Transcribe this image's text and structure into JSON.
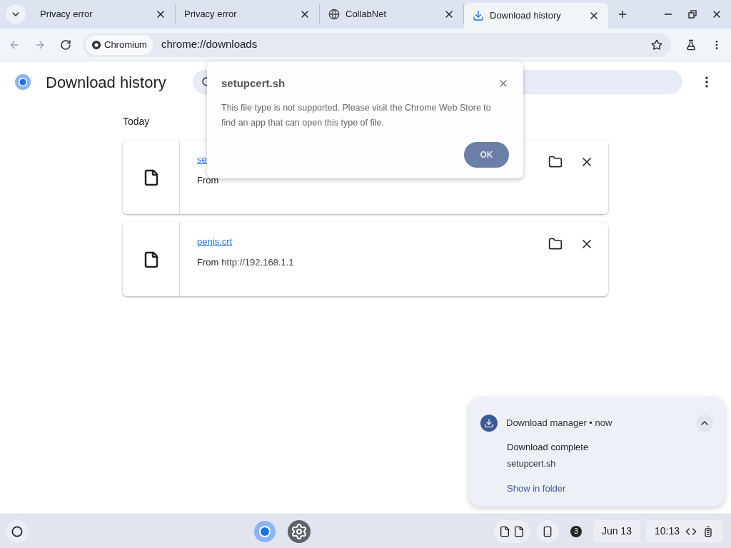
{
  "tabs": [
    {
      "title": "Privacy error",
      "kind": "plain",
      "selected": false
    },
    {
      "title": "Privacy error",
      "kind": "plain",
      "selected": false
    },
    {
      "title": "CollabNet",
      "kind": "site",
      "selected": false
    },
    {
      "title": "Download history",
      "kind": "download",
      "selected": true
    }
  ],
  "omnibox": {
    "chip": "Chromium",
    "url": "chrome://downloads"
  },
  "page": {
    "title": "Download history",
    "section": "Today",
    "downloads": [
      {
        "name": "se",
        "from_label": "From"
      },
      {
        "name": "penis.crt",
        "from_label": "From",
        "source": "http://192.168.1.1"
      }
    ]
  },
  "dialog": {
    "title": "setupcert.sh",
    "message": "This file type is not supported. Please visit the Chrome Web Store to find an app that can open this type of file.",
    "button": "OK"
  },
  "notification": {
    "app": "Download manager",
    "separator": "•",
    "time": "now",
    "title": "Download complete",
    "filename": "setupcert.sh",
    "action": "Show in folder"
  },
  "shelf": {
    "badge": "3",
    "date": "Jun 13",
    "time": "10:13"
  }
}
